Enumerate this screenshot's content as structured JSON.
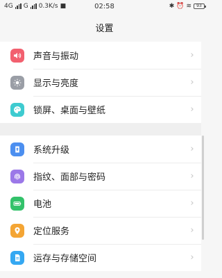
{
  "status_bar": {
    "network_1": "4G",
    "network_2": "G",
    "speed": "0.3K/s",
    "time": "02:58",
    "battery": "93"
  },
  "header": {
    "title": "设置"
  },
  "groups": [
    {
      "items": [
        {
          "label": "声音与振动",
          "icon": "speaker-icon",
          "color": "#f2606f"
        },
        {
          "label": "显示与亮度",
          "icon": "brightness-icon",
          "color": "#9a9ea6"
        },
        {
          "label": "锁屏、桌面与壁纸",
          "icon": "palette-icon",
          "color": "#3ecbd0"
        }
      ]
    },
    {
      "items": [
        {
          "label": "系统升级",
          "icon": "system-update-icon",
          "color": "#4c8ff0"
        },
        {
          "label": "指纹、面部与密码",
          "icon": "fingerprint-icon",
          "color": "#9b78e8"
        },
        {
          "label": "电池",
          "icon": "battery-icon",
          "color": "#33c26a"
        },
        {
          "label": "定位服务",
          "icon": "location-icon",
          "color": "#f4a534"
        },
        {
          "label": "运存与存储空间",
          "icon": "storage-icon",
          "color": "#35a8f2"
        }
      ]
    }
  ]
}
